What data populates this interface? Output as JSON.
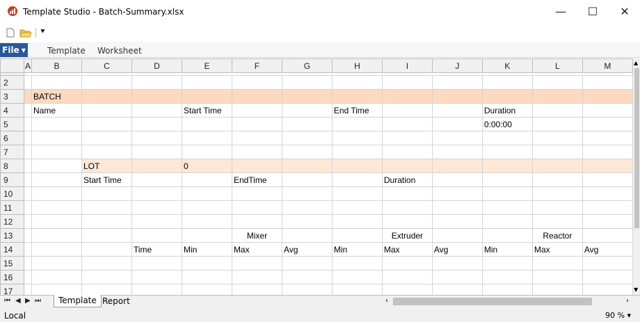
{
  "window": {
    "title": "Template Studio - Batch-Summary.xlsx",
    "minimize_glyph": "—",
    "maximize_glyph": "☐",
    "close_glyph": "✕"
  },
  "ribbon": {
    "file_label": "File",
    "tabs": [
      "Template",
      "Worksheet"
    ]
  },
  "grid": {
    "columns": [
      "A",
      "B",
      "C",
      "D",
      "E",
      "F",
      "G",
      "H",
      "I",
      "J",
      "K",
      "L",
      "M"
    ],
    "rows": [
      {
        "num": "2",
        "cells": [
          "",
          "",
          "",
          "",
          "",
          "",
          "",
          "",
          "",
          "",
          "",
          "",
          ""
        ]
      },
      {
        "num": "3",
        "cells": [
          "",
          "BATCH",
          "",
          "",
          "",
          "",
          "",
          "",
          "",
          "",
          "",
          "",
          ""
        ]
      },
      {
        "num": "4",
        "cells": [
          "",
          "Name",
          "",
          "",
          "Start Time",
          "",
          "",
          "End Time",
          "",
          "",
          "Duration",
          "",
          ""
        ]
      },
      {
        "num": "5",
        "cells": [
          "",
          "",
          "",
          "",
          "",
          "",
          "",
          "",
          "",
          "",
          "0:00:00",
          "",
          ""
        ]
      },
      {
        "num": "6",
        "cells": [
          "",
          "",
          "",
          "",
          "",
          "",
          "",
          "",
          "",
          "",
          "",
          "",
          ""
        ]
      },
      {
        "num": "7",
        "cells": [
          "",
          "",
          "",
          "",
          "",
          "",
          "",
          "",
          "",
          "",
          "",
          "",
          ""
        ]
      },
      {
        "num": "8",
        "cells": [
          "",
          "",
          "LOT",
          "",
          "0",
          "",
          "",
          "",
          "",
          "",
          "",
          "",
          ""
        ]
      },
      {
        "num": "9",
        "cells": [
          "",
          "",
          "Start Time",
          "",
          "",
          "EndTime",
          "",
          "",
          "Duration",
          "",
          "",
          "",
          ""
        ]
      },
      {
        "num": "10",
        "cells": [
          "",
          "",
          "",
          "",
          "",
          "",
          "",
          "",
          "",
          "",
          "",
          "",
          ""
        ]
      },
      {
        "num": "11",
        "cells": [
          "",
          "",
          "",
          "",
          "",
          "",
          "",
          "",
          "",
          "",
          "",
          "",
          ""
        ]
      },
      {
        "num": "12",
        "cells": [
          "",
          "",
          "",
          "",
          "",
          "",
          "",
          "",
          "",
          "",
          "",
          "",
          ""
        ]
      },
      {
        "num": "13",
        "cells": [
          "",
          "",
          "",
          "",
          "",
          "Mixer",
          "",
          "",
          "Extruder",
          "",
          "",
          "Reactor",
          ""
        ]
      },
      {
        "num": "14",
        "cells": [
          "",
          "",
          "",
          "Time",
          "Min",
          "Max",
          "Avg",
          "Min",
          "Max",
          "Avg",
          "Min",
          "Max",
          "Avg"
        ]
      },
      {
        "num": "15",
        "cells": [
          "",
          "",
          "",
          "",
          "",
          "",
          "",
          "",
          "",
          "",
          "",
          "",
          ""
        ]
      },
      {
        "num": "16",
        "cells": [
          "",
          "",
          "",
          "",
          "",
          "",
          "",
          "",
          "",
          "",
          "",
          "",
          ""
        ]
      },
      {
        "num": "17",
        "cells": [
          "",
          "",
          "",
          "",
          "",
          "",
          "",
          "",
          "",
          "",
          "",
          "",
          ""
        ]
      }
    ]
  },
  "sheets": {
    "nav": [
      "⏮",
      "◀",
      "▶",
      "⏭"
    ],
    "tabs": [
      "Template",
      "Report"
    ]
  },
  "status": {
    "left": "Local",
    "zoom": "90 % ▾"
  },
  "colors": {
    "batch_fill": "#fcd9bf",
    "lot_fill": "#fde7d7",
    "file_tab": "#2b579a"
  }
}
